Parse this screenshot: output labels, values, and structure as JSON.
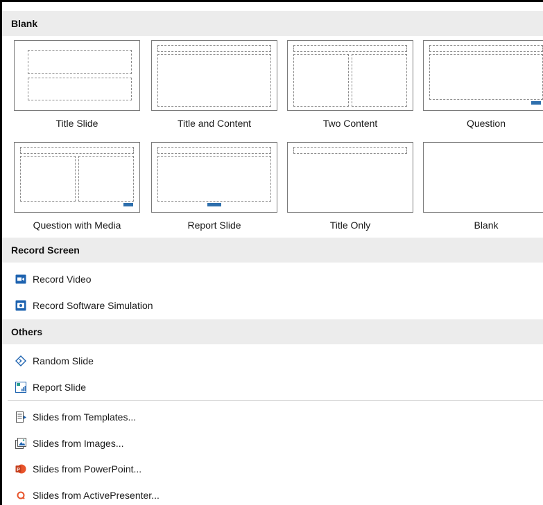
{
  "sections": {
    "blank": {
      "title": "Blank"
    },
    "record": {
      "title": "Record Screen"
    },
    "others": {
      "title": "Others"
    }
  },
  "layouts": [
    {
      "label": "Title Slide",
      "thumb": "title-slide"
    },
    {
      "label": "Title and Content",
      "thumb": "title-and-content"
    },
    {
      "label": "Two Content",
      "thumb": "two-content"
    },
    {
      "label": "Question",
      "thumb": "question"
    },
    {
      "label": "Question with Media",
      "thumb": "question-with-media"
    },
    {
      "label": "Report Slide",
      "thumb": "report-slide"
    },
    {
      "label": "Title Only",
      "thumb": "title-only"
    },
    {
      "label": "Blank",
      "thumb": "blank"
    }
  ],
  "record_items": [
    {
      "label": "Record Video",
      "icon": "video-camera-icon"
    },
    {
      "label": "Record Software Simulation",
      "icon": "screen-record-icon"
    }
  ],
  "other_items": [
    {
      "label": "Random Slide",
      "icon": "diamond-icon"
    },
    {
      "label": "Report Slide",
      "icon": "report-chart-icon"
    }
  ],
  "import_items": [
    {
      "label": "Slides from Templates...",
      "icon": "template-icon"
    },
    {
      "label": "Slides from Images...",
      "icon": "image-icon"
    },
    {
      "label": "Slides from PowerPoint...",
      "icon": "powerpoint-icon"
    },
    {
      "label": "Slides from ActivePresenter...",
      "icon": "activepresenter-icon"
    }
  ],
  "colors": {
    "badge": "#2e6fad",
    "header_bg": "#ececec",
    "icon_blue": "#1e63b0",
    "powerpoint_red": "#c43e1c",
    "activepresenter_orange": "#e8542b"
  }
}
